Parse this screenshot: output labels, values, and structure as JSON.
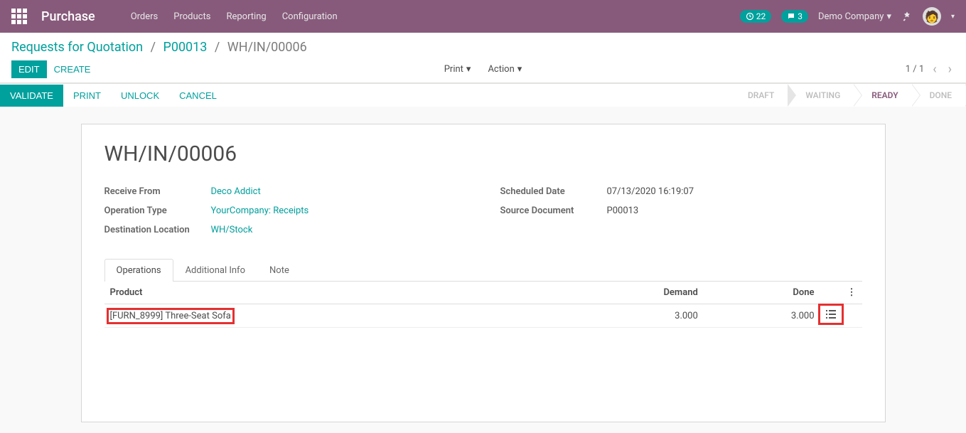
{
  "nav": {
    "brand": "Purchase",
    "menu": [
      "Orders",
      "Products",
      "Reporting",
      "Configuration"
    ],
    "badges": {
      "activity": "22",
      "messages": "3"
    },
    "company": "Demo Company"
  },
  "breadcrumb": {
    "items": [
      "Requests for Quotation",
      "P00013"
    ],
    "current": "WH/IN/00006"
  },
  "controls": {
    "edit": "EDIT",
    "create": "CREATE",
    "print": "Print",
    "action": "Action",
    "pager": "1 / 1"
  },
  "statusbar": {
    "buttons": [
      "VALIDATE",
      "PRINT",
      "UNLOCK",
      "CANCEL"
    ],
    "steps": [
      "DRAFT",
      "WAITING",
      "READY",
      "DONE"
    ],
    "active": "READY"
  },
  "record": {
    "title": "WH/IN/00006",
    "fields": {
      "receive_from_label": "Receive From",
      "receive_from": "Deco Addict",
      "operation_type_label": "Operation Type",
      "operation_type": "YourCompany: Receipts",
      "destination_label": "Destination Location",
      "destination": "WH/Stock",
      "scheduled_label": "Scheduled Date",
      "scheduled": "07/13/2020 16:19:07",
      "source_label": "Source Document",
      "source": "P00013"
    }
  },
  "tabs": [
    "Operations",
    "Additional Info",
    "Note"
  ],
  "table": {
    "headers": {
      "product": "Product",
      "demand": "Demand",
      "done": "Done"
    },
    "rows": [
      {
        "product": "[FURN_8999] Three-Seat Sofa",
        "demand": "3.000",
        "done": "3.000"
      }
    ]
  }
}
